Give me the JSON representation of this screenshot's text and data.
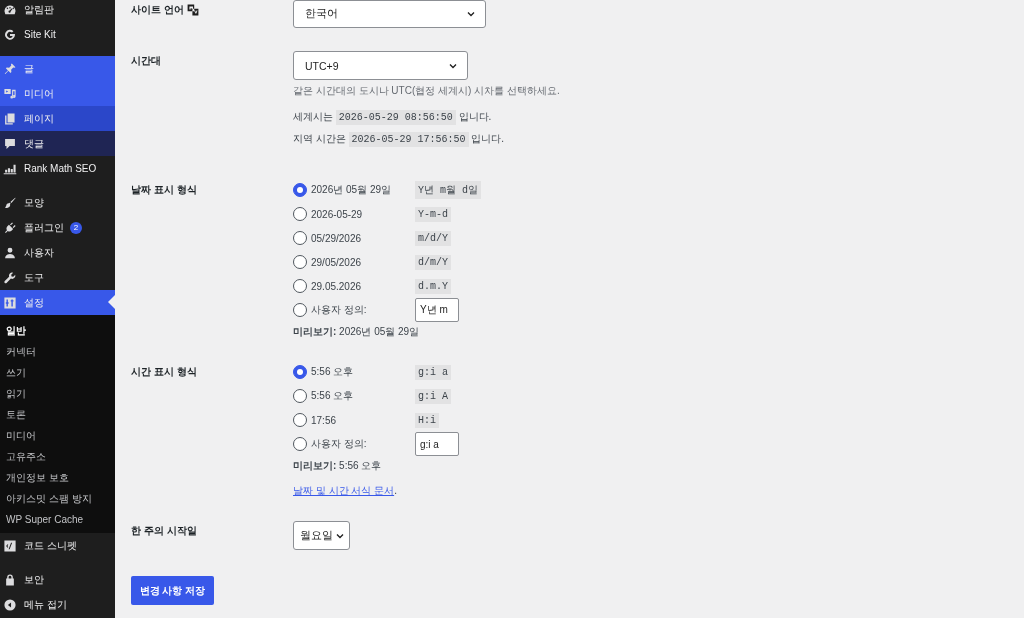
{
  "sidebar": {
    "groups": [
      {
        "items": [
          {
            "label": "알림판",
            "selected": false
          },
          {
            "label": "Site Kit",
            "selected": false
          }
        ]
      },
      {
        "items": [
          {
            "label": "글",
            "selected": false,
            "color": "#3858e9"
          },
          {
            "label": "미디어",
            "selected": false,
            "color": "#3858e9"
          },
          {
            "label": "페이지",
            "selected": false,
            "color": "#2b47c9"
          },
          {
            "label": "댓글",
            "selected": false,
            "color": "#1f2554"
          },
          {
            "label": "Rank Math SEO",
            "selected": false
          }
        ]
      },
      {
        "items": [
          {
            "label": "모양",
            "selected": false
          },
          {
            "label": "플러그인",
            "selected": false,
            "badge": "2"
          },
          {
            "label": "사용자",
            "selected": false
          },
          {
            "label": "도구",
            "selected": false
          },
          {
            "label": "설정",
            "selected": true,
            "submenu": [
              {
                "label": "일반",
                "selected": true
              },
              {
                "label": "커넥터",
                "selected": false
              },
              {
                "label": "쓰기",
                "selected": false
              },
              {
                "label": "읽기",
                "selected": false
              },
              {
                "label": "토론",
                "selected": false
              },
              {
                "label": "미디어",
                "selected": false
              },
              {
                "label": "고유주소",
                "selected": false
              },
              {
                "label": "개인정보 보호",
                "selected": false
              },
              {
                "label": "아키스밋 스팸 방지",
                "selected": false
              },
              {
                "label": "WP Super Cache",
                "selected": false
              }
            ]
          },
          {
            "label": "코드 스니펫",
            "selected": false
          }
        ]
      },
      {
        "items": [
          {
            "label": "보안",
            "selected": false
          }
        ]
      }
    ],
    "collapse_button": "메뉴 접기"
  },
  "settings": {
    "site_language": {
      "label": "사이트 언어",
      "value": "한국어"
    },
    "timezone": {
      "label": "시간대",
      "value": "UTC+9",
      "description": "같은 시간대의 도시나 UTC(협정 세계시) 시차를 선택하세요.",
      "times": [
        {
          "prefix": "세계시는",
          "time": "2026-05-29 08:56:50",
          "suffix": "입니다."
        },
        {
          "prefix": "지역 시간은",
          "time": "2026-05-29 17:56:50",
          "suffix": "입니다."
        }
      ]
    },
    "date_format": {
      "label": "날짜 표시 형식",
      "options": [
        {
          "kind": "preset",
          "label": "2026년 05월 29일",
          "code": "Y년 m월 d일",
          "selected": true
        },
        {
          "kind": "preset",
          "label": "2026-05-29",
          "code": "Y-m-d",
          "selected": false
        },
        {
          "kind": "preset",
          "label": "05/29/2026",
          "code": "m/d/Y",
          "selected": false
        },
        {
          "kind": "preset",
          "label": "29/05/2026",
          "code": "d/m/Y",
          "selected": false
        },
        {
          "kind": "preset",
          "label": "29.05.2026",
          "code": "d.m.Y",
          "selected": false
        },
        {
          "kind": "custom",
          "label": "사용자 정의:",
          "value": "Y년 m",
          "selected": false
        }
      ],
      "preview": "**미리보기:** 2026년 05월 29일"
    },
    "time_format": {
      "label": "시간 표시 형식",
      "options": [
        {
          "kind": "preset",
          "label": "5:56 오후",
          "code": "g:i a",
          "selected": true
        },
        {
          "kind": "preset",
          "label": "5:56 오후",
          "code": "g:i A",
          "selected": false
        },
        {
          "kind": "preset",
          "label": "17:56",
          "code": "H:i",
          "selected": false
        },
        {
          "kind": "custom",
          "label": "사용자 정의:",
          "value": "g:i a",
          "selected": false
        }
      ],
      "preview": "**미리보기:** 5:56 오후",
      "doc_link": {
        "text": "날짜 및 시간 서식 문서",
        "suffix": "."
      }
    },
    "week_start": {
      "label": "한 주의 시작일",
      "value": "월요일"
    }
  },
  "save_button": "변경 사항 저장"
}
